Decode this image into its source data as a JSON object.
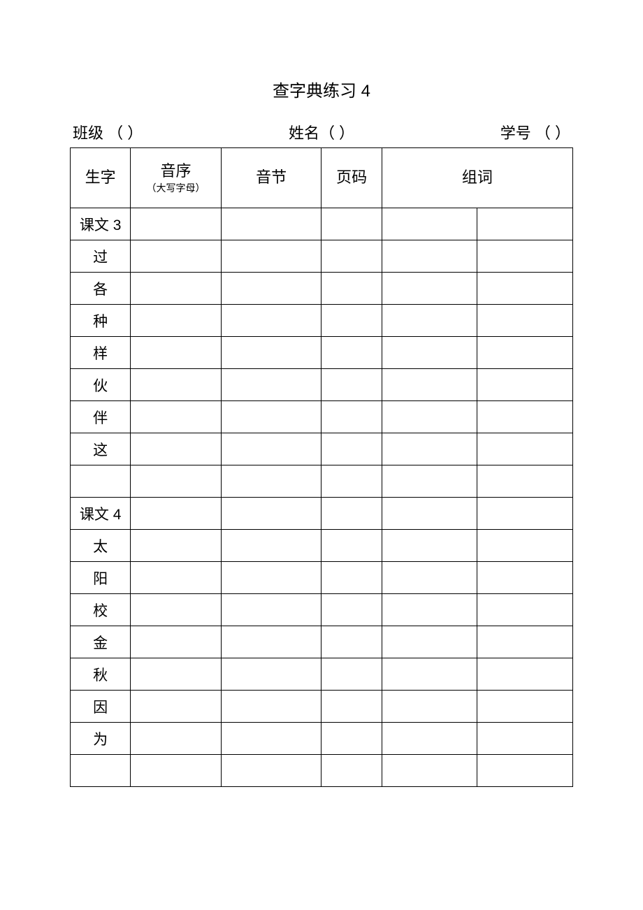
{
  "title": "查字典练习 4",
  "info": {
    "class_label": "班级 （        ）",
    "name_label": "姓名（             ）",
    "number_label": "学号 （        ）"
  },
  "headers": {
    "char": "生字",
    "sequence": "音序",
    "sequence_sub": "（大写字母）",
    "syllable": "音节",
    "page": "页码",
    "words": "组词"
  },
  "rows": [
    {
      "char": "课文 3"
    },
    {
      "char": "过"
    },
    {
      "char": "各"
    },
    {
      "char": "种"
    },
    {
      "char": "样"
    },
    {
      "char": "伙"
    },
    {
      "char": "伴"
    },
    {
      "char": "这"
    },
    {
      "char": ""
    },
    {
      "char": "课文 4"
    },
    {
      "char": "太"
    },
    {
      "char": "阳"
    },
    {
      "char": "校"
    },
    {
      "char": "金"
    },
    {
      "char": "秋"
    },
    {
      "char": "因"
    },
    {
      "char": "为"
    },
    {
      "char": ""
    }
  ]
}
